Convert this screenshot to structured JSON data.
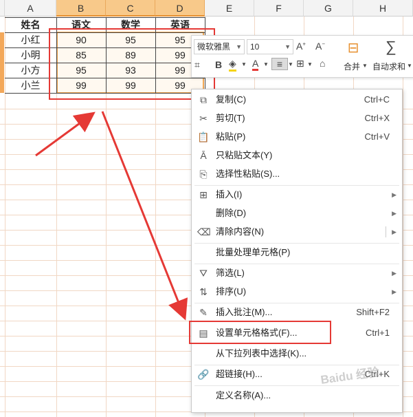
{
  "columns": [
    "A",
    "B",
    "C",
    "D",
    "E",
    "F",
    "G",
    "H"
  ],
  "table": {
    "headers": [
      "姓名",
      "语文",
      "数学",
      "英语"
    ],
    "rows": [
      [
        "小红",
        "90",
        "95",
        "95"
      ],
      [
        "小明",
        "85",
        "89",
        "99"
      ],
      [
        "小方",
        "95",
        "93",
        "99"
      ],
      [
        "小兰",
        "99",
        "99",
        "99"
      ]
    ]
  },
  "mini_toolbar": {
    "font_name": "微软雅黑",
    "font_size": "10",
    "merge_label": "合并",
    "autosum_label": "自动求和"
  },
  "context_menu": {
    "items": [
      {
        "label": "复制(C)",
        "shortcut": "Ctrl+C",
        "icon": "copy-icon"
      },
      {
        "label": "剪切(T)",
        "shortcut": "Ctrl+X",
        "icon": "scissors-icon"
      },
      {
        "label": "粘贴(P)",
        "shortcut": "Ctrl+V",
        "icon": "paste-icon"
      },
      {
        "label": "只粘贴文本(Y)",
        "shortcut": "",
        "icon": "paste-text-icon"
      },
      {
        "label": "选择性粘贴(S)...",
        "shortcut": "",
        "icon": "paste-special-icon"
      },
      {
        "label": "插入(I)",
        "shortcut": "",
        "icon": "insert-icon"
      },
      {
        "label": "删除(D)",
        "shortcut": "",
        "icon": ""
      },
      {
        "label": "清除内容(N)",
        "shortcut": "",
        "icon": "eraser-icon"
      },
      {
        "label": "批量处理单元格(P)",
        "shortcut": "",
        "icon": ""
      },
      {
        "label": "筛选(L)",
        "shortcut": "",
        "icon": "filter-icon"
      },
      {
        "label": "排序(U)",
        "shortcut": "",
        "icon": "sort-icon"
      },
      {
        "label": "插入批注(M)...",
        "shortcut": "Shift+F2",
        "icon": "comment-icon"
      },
      {
        "label": "设置单元格格式(F)...",
        "shortcut": "Ctrl+1",
        "icon": "format-cells-icon"
      },
      {
        "label": "从下拉列表中选择(K)...",
        "shortcut": "",
        "icon": ""
      },
      {
        "label": "超链接(H)...",
        "shortcut": "Ctrl+K",
        "icon": "link-icon"
      },
      {
        "label": "定义名称(A)...",
        "shortcut": "",
        "icon": ""
      }
    ]
  },
  "watermark": "Baidu 经验",
  "colors": {
    "selection_header": "#f8c98a",
    "annotation_red": "#e53935",
    "grid_line": "#f1d7c4"
  }
}
